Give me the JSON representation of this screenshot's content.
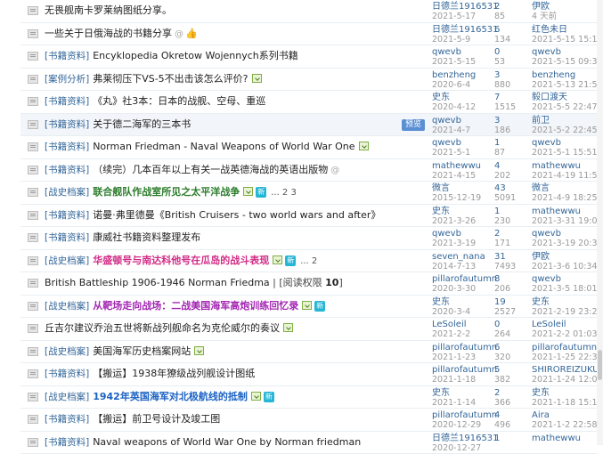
{
  "threads": [
    {
      "category": "",
      "title": "无畏舰南卡罗莱纳图纸分享。",
      "style": "normal",
      "attach": false,
      "badge": "",
      "clip": false,
      "thumb": false,
      "pages": "",
      "perm": "",
      "preview": "",
      "highlight": false,
      "author": "日德兰1916531",
      "date": "2021-5-17",
      "replies": "2",
      "views": "85",
      "last_user": "伊欧",
      "last_time": "4 天前"
    },
    {
      "category": "",
      "title": "一些关于日俄海战的书籍分享",
      "style": "normal",
      "attach": false,
      "badge": "",
      "clip": true,
      "thumb": true,
      "pages": "",
      "perm": "",
      "preview": "",
      "highlight": false,
      "author": "日德兰1916531",
      "date": "2021-5-9",
      "replies": "6",
      "views": "134",
      "last_user": "红色未日",
      "last_time": "2021-5-15 15:13"
    },
    {
      "category": "[书籍资料]",
      "title": "Encyklopedia Okretow Wojennych系列书籍",
      "style": "normal",
      "attach": false,
      "badge": "",
      "clip": false,
      "thumb": false,
      "pages": "",
      "perm": "",
      "preview": "",
      "highlight": false,
      "author": "qwevb",
      "date": "2021-5-15",
      "replies": "0",
      "views": "53",
      "last_user": "qwevb",
      "last_time": "2021-5-15 09:37"
    },
    {
      "category": "[案例分析]",
      "title": "弗莱彻压下VS-5不出击该怎么评价?",
      "style": "normal",
      "attach": true,
      "badge": "",
      "clip": false,
      "thumb": false,
      "pages": "",
      "perm": "",
      "preview": "",
      "highlight": false,
      "author": "benzheng",
      "date": "2020-6-4",
      "replies": "3",
      "views": "880",
      "last_user": "benzheng",
      "last_time": "2021-5-13 21:56"
    },
    {
      "category": "[书籍资料]",
      "title": "《丸》社3本：日本的战舰、空母、重巡",
      "style": "normal",
      "attach": false,
      "badge": "",
      "clip": false,
      "thumb": false,
      "pages": "",
      "perm": "",
      "preview": "",
      "highlight": false,
      "author": "史东",
      "date": "2020-4-12",
      "replies": "7",
      "views": "1515",
      "last_user": "毅口渡天",
      "last_time": "2021-5-5 22:47"
    },
    {
      "category": "[书籍资料]",
      "title": "关于德二海军的三本书",
      "style": "normal",
      "attach": false,
      "badge": "",
      "clip": false,
      "thumb": false,
      "pages": "",
      "perm": "",
      "preview": "预览",
      "highlight": true,
      "author": "qwevb",
      "date": "2021-4-7",
      "replies": "3",
      "views": "186",
      "last_user": "前卫",
      "last_time": "2021-5-2 22:45"
    },
    {
      "category": "[书籍资料]",
      "title": "Norman Friedman - Naval Weapons of World War One",
      "style": "normal",
      "attach": true,
      "badge": "",
      "clip": false,
      "thumb": false,
      "pages": "",
      "perm": "",
      "preview": "",
      "highlight": false,
      "author": "qwevb",
      "date": "2021-5-1",
      "replies": "1",
      "views": "87",
      "last_user": "qwevb",
      "last_time": "2021-5-1 15:51"
    },
    {
      "category": "[书籍资料]",
      "title": "（续完）几本百年以上有关一战英德海战的英语出版物",
      "style": "normal",
      "attach": false,
      "badge": "",
      "clip": true,
      "thumb": false,
      "pages": "",
      "perm": "",
      "preview": "",
      "highlight": false,
      "author": "mathewwu",
      "date": "2021-4-15",
      "replies": "4",
      "views": "202",
      "last_user": "mathewwu",
      "last_time": "2021-4-19 11:58"
    },
    {
      "category": "[战史档案]",
      "title": "联合舰队作战室所见之太平洋战争",
      "style": "green",
      "attach": true,
      "badge": "新",
      "clip": false,
      "thumb": false,
      "pages": "... 2  3",
      "perm": "",
      "preview": "",
      "highlight": false,
      "author": "微言",
      "date": "2015-12-19",
      "replies": "43",
      "views": "5091",
      "last_user": "微言",
      "last_time": "2021-4-9 18:25"
    },
    {
      "category": "[书籍资料]",
      "title": "诺曼·弗里德曼《British Cruisers - two world wars and after》",
      "style": "normal",
      "attach": false,
      "badge": "",
      "clip": false,
      "thumb": false,
      "pages": "",
      "perm": "",
      "preview": "",
      "highlight": false,
      "author": "史东",
      "date": "2021-3-26",
      "replies": "1",
      "views": "230",
      "last_user": "mathewwu",
      "last_time": "2021-3-31 19:06"
    },
    {
      "category": "[书籍资料]",
      "title": "康威社书籍资料整理发布",
      "style": "normal",
      "attach": false,
      "badge": "",
      "clip": false,
      "thumb": false,
      "pages": "",
      "perm": "",
      "preview": "",
      "highlight": false,
      "author": "qwevb",
      "date": "2021-3-19",
      "replies": "2",
      "views": "171",
      "last_user": "qwevb",
      "last_time": "2021-3-19 20:36"
    },
    {
      "category": "[战史档案]",
      "title": "华盛顿号与南达科他号在瓜岛的战斗表现",
      "style": "pink",
      "attach": true,
      "badge": "新",
      "clip": false,
      "thumb": false,
      "pages": "... 2",
      "perm": "",
      "preview": "",
      "highlight": false,
      "author": "seven_nana",
      "date": "2014-7-13",
      "replies": "31",
      "views": "7493",
      "last_user": "伊欧",
      "last_time": "2021-3-6 10:34"
    },
    {
      "category": "",
      "title": "British Battleship 1906-1946 Norman Friedma",
      "style": "normal",
      "attach": false,
      "badge": "",
      "clip": false,
      "thumb": false,
      "pages": "",
      "perm": "10",
      "preview": "",
      "highlight": false,
      "author": "pillarofautumn",
      "date": "2020-3-30",
      "replies": "8",
      "views": "206",
      "last_user": "qwevb",
      "last_time": "2021-3-5 18:01"
    },
    {
      "category": "[战史档案]",
      "title": "从靶场走向战场：二战美国海军高炮训练回忆录",
      "style": "purple",
      "attach": true,
      "badge": "新",
      "clip": false,
      "thumb": false,
      "pages": "",
      "perm": "",
      "preview": "",
      "highlight": false,
      "author": "史东",
      "date": "2020-3-4",
      "replies": "19",
      "views": "2527",
      "last_user": "史东",
      "last_time": "2021-2-19 23:24"
    },
    {
      "category": "",
      "title": "丘吉尔建议乔治五世将新战列舰命名为克伦威尔的奏议",
      "style": "normal",
      "attach": true,
      "badge": "",
      "clip": false,
      "thumb": false,
      "pages": "",
      "perm": "",
      "preview": "",
      "highlight": false,
      "author": "LeSoleil",
      "date": "2021-2-2",
      "replies": "0",
      "views": "264",
      "last_user": "LeSoleil",
      "last_time": "2021-2-2 01:03"
    },
    {
      "category": "[战史档案]",
      "title": "美国海军历史档案网站",
      "style": "normal",
      "attach": true,
      "badge": "",
      "clip": false,
      "thumb": false,
      "pages": "",
      "perm": "",
      "preview": "",
      "highlight": false,
      "author": "pillarofautumn",
      "date": "2021-1-23",
      "replies": "6",
      "views": "320",
      "last_user": "pillarofautumn",
      "last_time": "2021-1-25 22:30"
    },
    {
      "category": "[书籍资料]",
      "title": "【搬运】1938年獠级战列舰设计图纸",
      "style": "normal",
      "attach": false,
      "badge": "",
      "clip": false,
      "thumb": false,
      "pages": "",
      "perm": "",
      "preview": "",
      "highlight": false,
      "author": "pillarofautumn",
      "date": "2021-1-18",
      "replies": "5",
      "views": "382",
      "last_user": "SHIROREIZUKU",
      "last_time": "2021-1-24 12:01"
    },
    {
      "category": "[战史档案]",
      "title": "1942年英国海军对北极航线的抵制",
      "style": "blue",
      "attach": true,
      "badge": "新",
      "clip": false,
      "thumb": false,
      "pages": "",
      "perm": "",
      "preview": "",
      "highlight": false,
      "author": "史东",
      "date": "2021-1-14",
      "replies": "2",
      "views": "366",
      "last_user": "史东",
      "last_time": "2021-1-18 15:10"
    },
    {
      "category": "[书籍资料]",
      "title": "【搬运】前卫号设计及竣工图",
      "style": "normal",
      "attach": false,
      "badge": "",
      "clip": false,
      "thumb": false,
      "pages": "",
      "perm": "",
      "preview": "",
      "highlight": false,
      "author": "pillarofautumn",
      "date": "2020-12-29",
      "replies": "4",
      "views": "496",
      "last_user": "Aira",
      "last_time": "2021-1-2 22:58"
    },
    {
      "category": "[书籍资料]",
      "title": "Naval weapons of World War One by Norman friedman",
      "style": "normal",
      "attach": false,
      "badge": "",
      "clip": false,
      "thumb": false,
      "pages": "",
      "perm": "",
      "preview": "",
      "highlight": false,
      "author": "日德兰1916531",
      "date": "2020-12-27",
      "replies": "1",
      "views": "",
      "last_user": "mathewwu",
      "last_time": ""
    }
  ],
  "perm_label_prefix": "[阅读权限 ",
  "perm_label_suffix": "]"
}
